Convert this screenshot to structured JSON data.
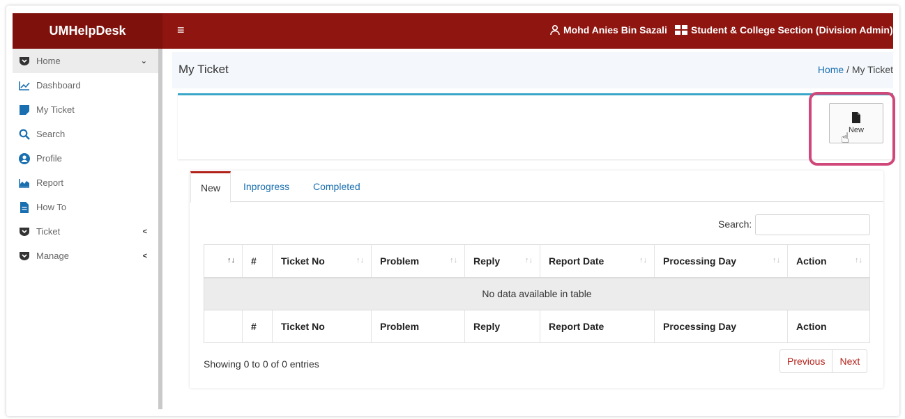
{
  "topbar": {
    "brand": "UMHelpDesk",
    "hamburger": "≡",
    "user_name": "Mohd Anies Bin Sazali",
    "department": "Student & College Section (Division Admin)",
    "bar_color": "#8f1510"
  },
  "sidebar": {
    "items": [
      {
        "label": "Home",
        "icon": "shield-down-icon",
        "chevron": "⌄"
      },
      {
        "label": "Dashboard",
        "icon": "line-chart-icon"
      },
      {
        "label": "My Ticket",
        "icon": "sticky-note-icon"
      },
      {
        "label": "Search",
        "icon": "search-icon"
      },
      {
        "label": "Profile",
        "icon": "user-circle-icon"
      },
      {
        "label": "Report",
        "icon": "area-chart-icon"
      },
      {
        "label": "How To",
        "icon": "document-icon"
      },
      {
        "label": "Ticket",
        "icon": "shield-down-icon",
        "chevron": "<"
      },
      {
        "label": "Manage",
        "icon": "shield-down-icon",
        "chevron": "<"
      }
    ]
  },
  "header": {
    "title": "My Ticket",
    "breadcrumb_home": "Home",
    "breadcrumb_sep": "/",
    "breadcrumb_current": "My Ticket"
  },
  "new_button": {
    "label": "New",
    "icon": "file-icon"
  },
  "tabs": [
    {
      "label": "New",
      "active": true
    },
    {
      "label": "Inprogress",
      "active": false
    },
    {
      "label": "Completed",
      "active": false
    }
  ],
  "search": {
    "label": "Search:",
    "value": ""
  },
  "table": {
    "columns": [
      "",
      "#",
      "Ticket No",
      "Problem",
      "Reply",
      "Report Date",
      "Processing Day",
      "Action"
    ],
    "empty_message": "No data available in table"
  },
  "footer": {
    "info": "Showing 0 to 0 of 0 entries",
    "previous": "Previous",
    "next": "Next"
  },
  "colors": {
    "accent": "#1a6fb0",
    "brand_red": "#8f1510",
    "highlight": "#d0487a",
    "card_border": "#3aa7c9"
  }
}
